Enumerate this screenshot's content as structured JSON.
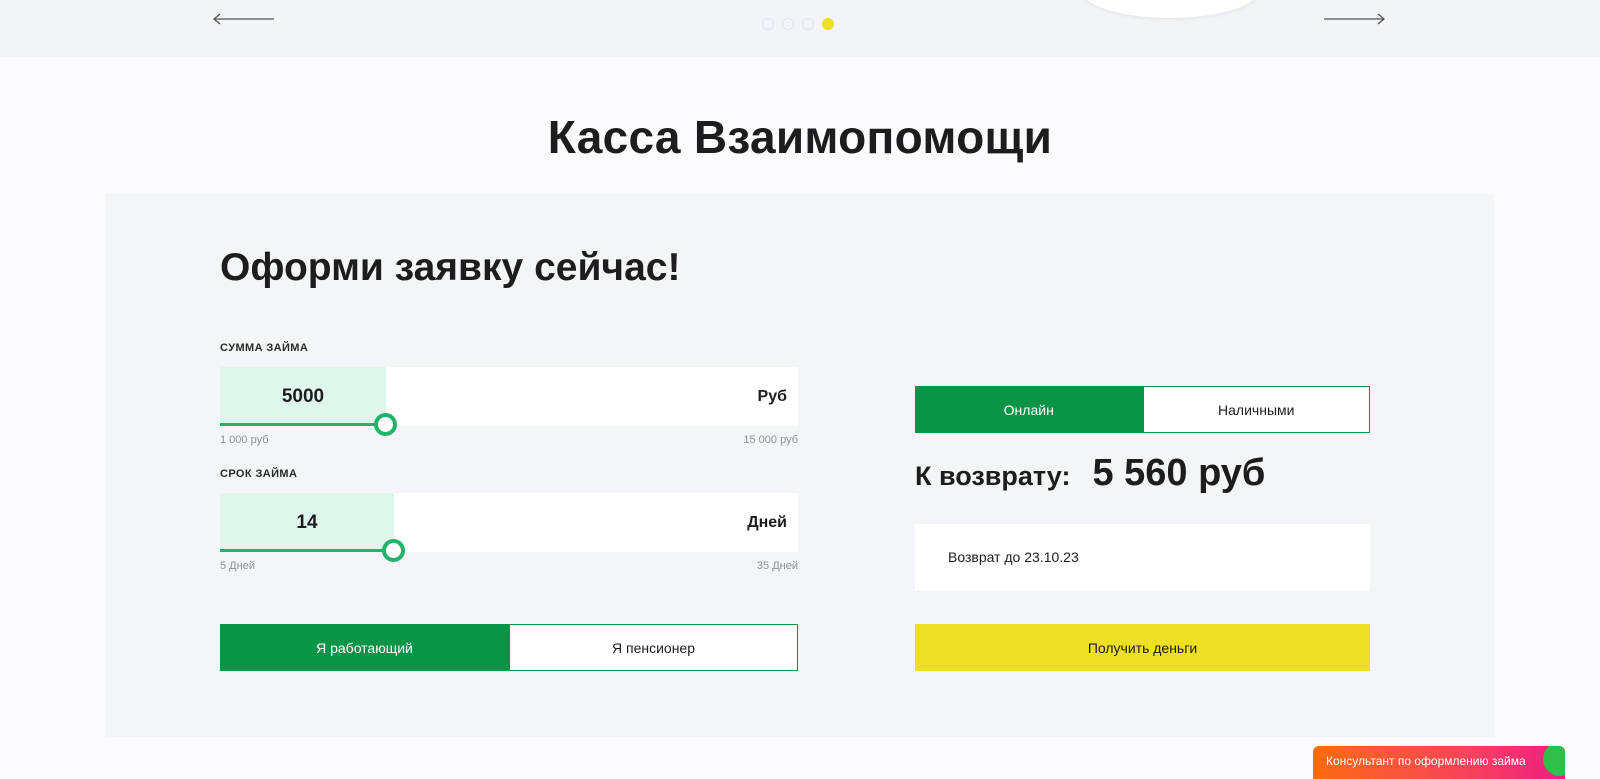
{
  "slider": {
    "dots_count": 4,
    "active_dot": 4
  },
  "title": "Касса Взаимопомощи",
  "form": {
    "heading": "Оформи заявку сейчас!",
    "amount": {
      "label": "СУММА ЗАЙМА",
      "value": "5000",
      "unit": "Руб",
      "min_label": "1 000 руб",
      "max_label": "15 000 руб",
      "min": 1000,
      "max": 15000,
      "current": 5000
    },
    "term": {
      "label": "СРОК ЗАЙМА",
      "value": "14",
      "unit": "Дней",
      "min_label": "5 Дней",
      "max_label": "35 Дней",
      "min": 5,
      "max": 35,
      "current": 14
    },
    "status_toggle": {
      "options": [
        "Я работающий",
        "Я пенсионер"
      ],
      "selected": 0
    }
  },
  "payout": {
    "method_toggle": {
      "options": [
        "Онлайн",
        "Наличными"
      ],
      "selected": 0
    },
    "return_label": "К возврату:",
    "return_amount": "5 560 руб",
    "return_date": "Возврат до 23.10.23",
    "submit_label": "Получить деньги"
  },
  "consultant": {
    "label": "Консультант по оформлению займа"
  },
  "colors": {
    "green": "#0a9448",
    "slider_green": "#21b36b",
    "slider_fill": "#dff7ea",
    "yellow": "#eddf22",
    "consultant_gradient": [
      "#fb6b12",
      "#ee1d84"
    ]
  },
  "icons": {
    "prev": "arrow-left-icon",
    "next": "arrow-right-icon"
  }
}
